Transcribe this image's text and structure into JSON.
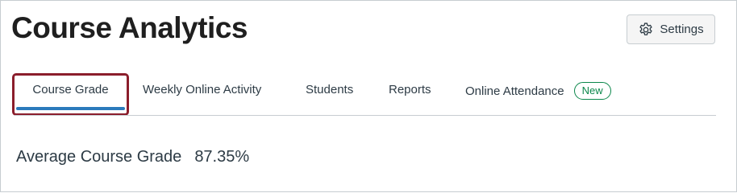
{
  "header": {
    "title": "Course Analytics",
    "settings_label": "Settings",
    "settings_icon": "gear-icon"
  },
  "tabs": [
    {
      "label": "Course Grade",
      "active": true
    },
    {
      "label": "Weekly Online Activity",
      "active": false
    },
    {
      "label": "Students",
      "active": false
    },
    {
      "label": "Reports",
      "active": false
    },
    {
      "label": "Online Attendance",
      "active": false,
      "badge": "New"
    }
  ],
  "summary": {
    "label": "Average Course Grade",
    "value": "87.35%"
  },
  "colors": {
    "active_tab_focus_ring": "#8b1e2c",
    "active_tab_underline": "#2b7abc",
    "new_badge": "#0b874b",
    "text": "#2d3b45"
  }
}
